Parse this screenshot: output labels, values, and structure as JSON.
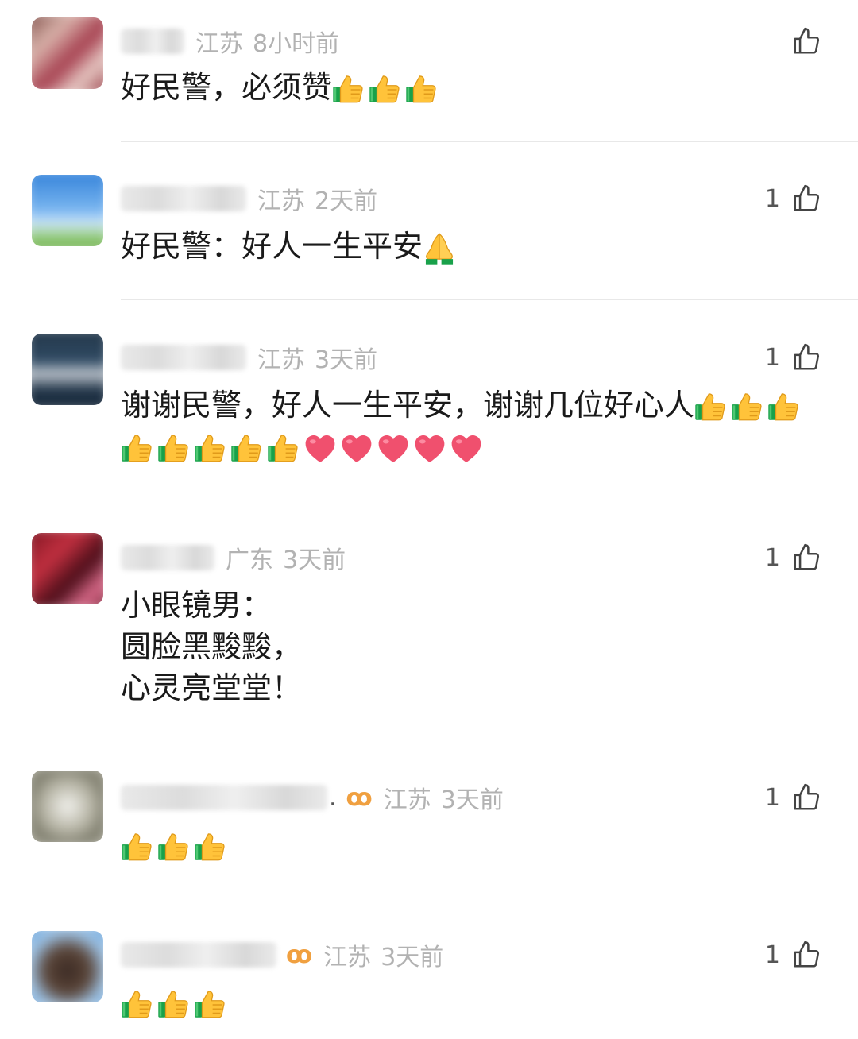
{
  "comments": [
    {
      "location": "江苏",
      "time": "8小时前",
      "likes": "",
      "text": "好民警，必须赞",
      "emojis": [
        "thumbs-up",
        "thumbs-up",
        "thumbs-up"
      ],
      "vip": "",
      "ellipsis": ""
    },
    {
      "location": "江苏",
      "time": "2天前",
      "likes": "1",
      "text": "好民警：好人一生平安",
      "emojis": [
        "folded-hands"
      ],
      "vip": "",
      "ellipsis": ""
    },
    {
      "location": "江苏",
      "time": "3天前",
      "likes": "1",
      "text": "谢谢民警，好人一生平安，谢谢几位好心人",
      "emojis": [
        "thumbs-up",
        "thumbs-up",
        "thumbs-up"
      ],
      "emojis2": [
        "thumbs-up",
        "thumbs-up",
        "thumbs-up",
        "thumbs-up",
        "thumbs-up",
        "heart",
        "heart",
        "heart",
        "heart",
        "heart"
      ],
      "vip": "",
      "ellipsis": ""
    },
    {
      "location": "广东",
      "time": "3天前",
      "likes": "1",
      "text": "小眼镜男：\n圆脸黑黢黢，\n心灵亮堂堂！",
      "emojis": [],
      "vip": "",
      "ellipsis": ""
    },
    {
      "location": "江苏",
      "time": "3天前",
      "likes": "1",
      "text": "",
      "emojis": [
        "thumbs-up",
        "thumbs-up",
        "thumbs-up"
      ],
      "vip": "ꝏ",
      "ellipsis": "."
    },
    {
      "location": "江苏",
      "time": "3天前",
      "likes": "1",
      "text": "",
      "emojis": [
        "thumbs-up",
        "thumbs-up",
        "thumbs-up"
      ],
      "vip": "ꝏ",
      "ellipsis": ""
    }
  ],
  "colors": {
    "meta": "#b2b2b2",
    "text": "#1a1a1a",
    "vip": "#f0a040",
    "heart": "#f0506e"
  }
}
